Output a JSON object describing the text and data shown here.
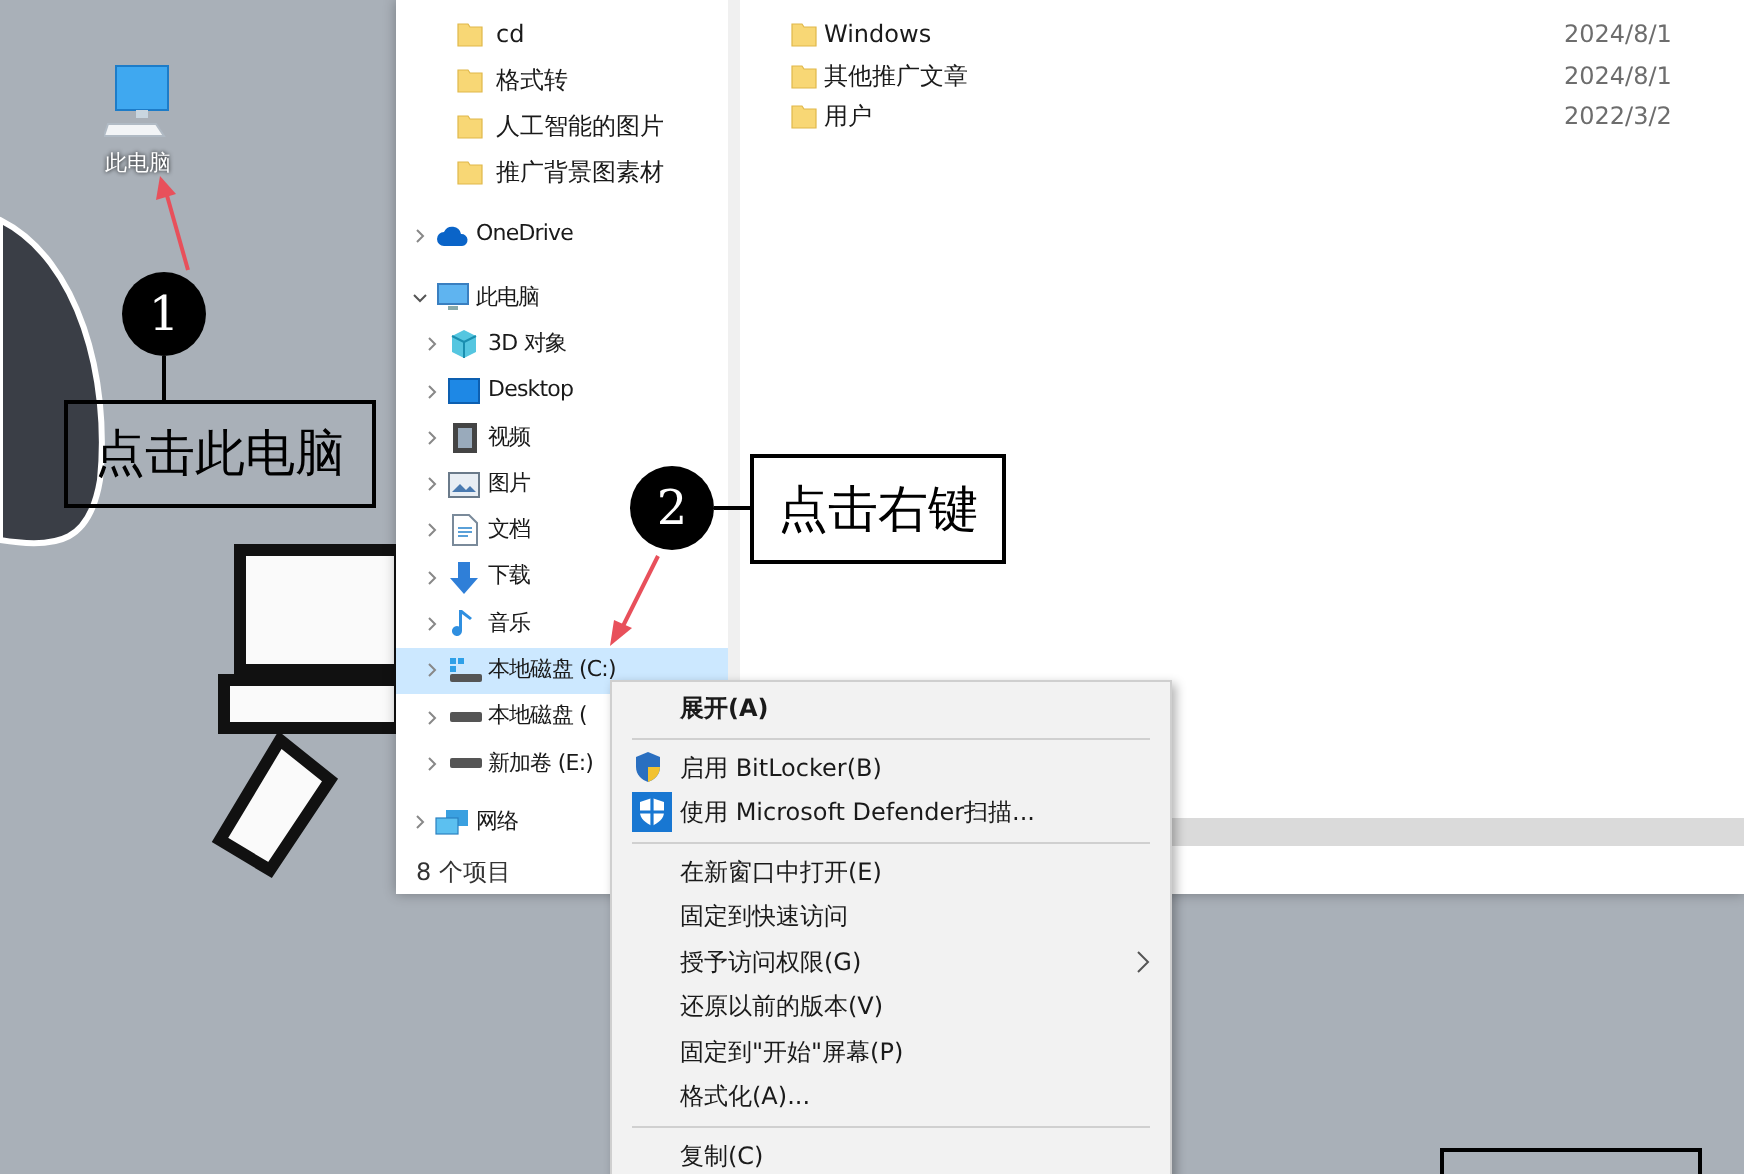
{
  "desktop": {
    "icons": [
      {
        "label": "此电脑"
      }
    ]
  },
  "annotations": [
    {
      "number": "1",
      "text": "点击此电脑"
    },
    {
      "number": "2",
      "text": "点击右键"
    }
  ],
  "explorer": {
    "quick_access_items": [
      {
        "kind": "folder",
        "label": "cd",
        "selected": false
      },
      {
        "kind": "folder",
        "label": "格式转",
        "selected": false
      },
      {
        "kind": "folder",
        "label": "人工智能的图片",
        "selected": false
      },
      {
        "kind": "folder",
        "label": "推广背景图素材",
        "selected": false
      }
    ],
    "tree": [
      {
        "kind": "cloud",
        "label": "OneDrive",
        "expanded": false,
        "selected": false
      },
      {
        "kind": "computer",
        "label": "此电脑",
        "expanded": true,
        "selected": false,
        "children": [
          {
            "kind": "cube",
            "label": "3D 对象",
            "expanded": false,
            "selected": false
          },
          {
            "kind": "desktop",
            "label": "Desktop",
            "expanded": false,
            "selected": false
          },
          {
            "kind": "video",
            "label": "视频",
            "expanded": false,
            "selected": false
          },
          {
            "kind": "picture",
            "label": "图片",
            "expanded": false,
            "selected": false
          },
          {
            "kind": "document",
            "label": "文档",
            "expanded": false,
            "selected": false
          },
          {
            "kind": "download",
            "label": "下载",
            "expanded": false,
            "selected": false
          },
          {
            "kind": "music",
            "label": "音乐",
            "expanded": false,
            "selected": false
          },
          {
            "kind": "system-drive",
            "label": "本地磁盘 (C:)",
            "expanded": false,
            "selected": true
          },
          {
            "kind": "drive",
            "label": "本地磁盘 (",
            "expanded": false,
            "selected": false
          },
          {
            "kind": "drive",
            "label": "新加卷 (E:)",
            "expanded": false,
            "selected": false
          }
        ]
      },
      {
        "kind": "network",
        "label": "网络",
        "expanded": false,
        "selected": false
      }
    ],
    "files": [
      {
        "name": "Windows",
        "date": "2024/8/1"
      },
      {
        "name": "其他推广文章",
        "date": "2024/8/1"
      },
      {
        "name": "用户",
        "date": "2022/3/2"
      }
    ],
    "status_bar": "8 个项目"
  },
  "context_menu": {
    "items": [
      {
        "kind": "item",
        "label": "展开(A)",
        "default": true,
        "has_submenu": false
      },
      {
        "kind": "separator"
      },
      {
        "kind": "encryption-item",
        "label": "启用 BitLocker(B)",
        "default": false,
        "has_submenu": false
      },
      {
        "kind": "scan-item",
        "label": "使用 Microsoft Defender扫描...",
        "default": false,
        "has_submenu": false
      },
      {
        "kind": "separator"
      },
      {
        "kind": "item",
        "label": "在新窗口中打开(E)",
        "default": false,
        "has_submenu": false
      },
      {
        "kind": "item",
        "label": "固定到快速访问",
        "default": false,
        "has_submenu": false
      },
      {
        "kind": "item",
        "label": "授予访问权限(G)",
        "default": false,
        "has_submenu": true
      },
      {
        "kind": "item",
        "label": "还原以前的版本(V)",
        "default": false,
        "has_submenu": false
      },
      {
        "kind": "item",
        "label": "固定到\"开始\"屏幕(P)",
        "default": false,
        "has_submenu": false
      },
      {
        "kind": "item",
        "label": "格式化(A)...",
        "default": false,
        "has_submenu": false
      },
      {
        "kind": "separator"
      },
      {
        "kind": "item",
        "label": "复制(C)",
        "default": false,
        "has_submenu": false
      }
    ]
  }
}
